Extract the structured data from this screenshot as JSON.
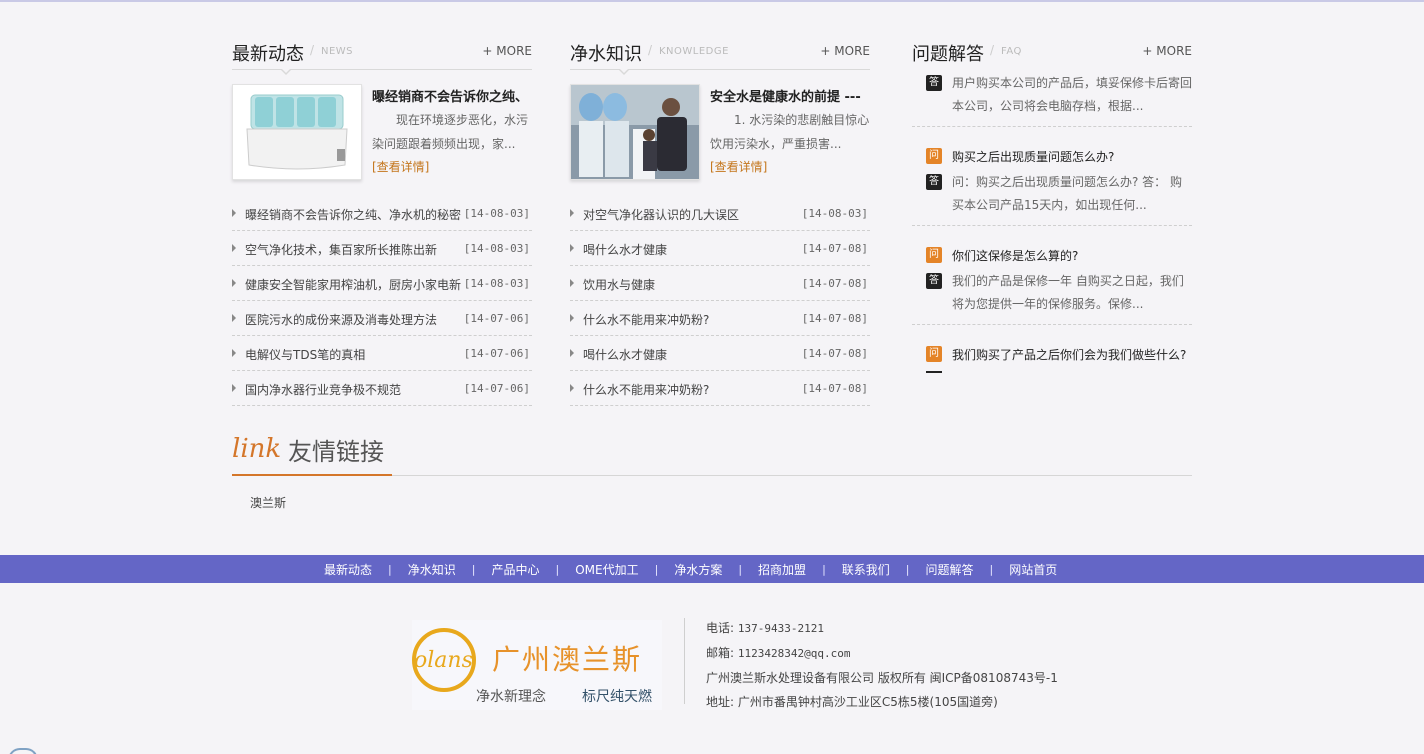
{
  "news": {
    "title": "最新动态",
    "en": "NEWS",
    "more": "+ MORE",
    "feature": {
      "title": "曝经销商不会告诉你之纯、",
      "desc": "现在环境逐步恶化，水污染问题跟着频频出现，家...",
      "link": "[查看详情]"
    },
    "items": [
      {
        "text": "曝经销商不会告诉你之纯、净水机的秘密",
        "date": "[14-08-03]"
      },
      {
        "text": "空气净化技术，集百家所长推陈出新",
        "date": "[14-08-03]"
      },
      {
        "text": "健康安全智能家用榨油机，厨房小家电新",
        "date": "[14-08-03]"
      },
      {
        "text": "医院污水的成份来源及消毒处理方法",
        "date": "[14-07-06]"
      },
      {
        "text": "电解仪与TDS笔的真相",
        "date": "[14-07-06]"
      },
      {
        "text": "国内净水器行业竞争极不规范",
        "date": "[14-07-06]"
      }
    ]
  },
  "knowledge": {
    "title": "净水知识",
    "en": "KNOWLEDGE",
    "more": "+ MORE",
    "feature": {
      "title": "安全水是健康水的前提 ---",
      "desc": "1. 水污染的悲剧触目惊心饮用污染水，严重损害...",
      "link": "[查看详情]"
    },
    "items": [
      {
        "text": "对空气净化器认识的几大误区",
        "date": "[14-08-03]"
      },
      {
        "text": "喝什么水才健康",
        "date": "[14-07-08]"
      },
      {
        "text": "饮用水与健康",
        "date": "[14-07-08]"
      },
      {
        "text": "什么水不能用来冲奶粉?",
        "date": "[14-07-08]"
      },
      {
        "text": "喝什么水才健康",
        "date": "[14-07-08]"
      },
      {
        "text": "什么水不能用来冲奶粉?",
        "date": "[14-07-08]"
      }
    ]
  },
  "faq": {
    "title": "问题解答",
    "en": "FAQ",
    "more": "+ MORE",
    "q_badge": "问",
    "a_badge": "答",
    "first_answer": "用户购买本公司的产品后，填妥保修卡后寄回本公司，公司将会电脑存档，根据...",
    "items": [
      {
        "q": "购买之后出现质量问题怎么办?",
        "a": "问：购买之后出现质量问题怎么办? 答： 购买本公司产品15天内，如出现任何..."
      },
      {
        "q": "你们这保修是怎么算的?",
        "a": "我们的产品是保修一年 自购买之日起，我们将为您提供一年的保修服务。保修..."
      },
      {
        "q": "我们购买了产品之后你们会为我们做些什么?",
        "a": ""
      }
    ]
  },
  "links": {
    "script": "link",
    "title": "友情链接",
    "items": [
      "澳兰斯"
    ]
  },
  "nav": {
    "items": [
      "最新动态",
      "净水知识",
      "产品中心",
      "OME代加工",
      "净水方案",
      "招商加盟",
      "联系我们",
      "问题解答",
      "网站首页"
    ],
    "sep": "|"
  },
  "footer": {
    "logo_mark": "olans",
    "logo_cn": "广州澳兰斯",
    "slogan1": "净水新理念",
    "slogan2": "标尺纯天燃",
    "phone_label": "电话:",
    "phone": "137-9433-2121",
    "email_label": "邮箱:",
    "email": "1123428342@qq.com",
    "copyright": "广州澳兰斯水处理设备有限公司 版权所有 闽ICP备08108743号-1",
    "address_label": "地址:",
    "address": "广州市番禺钟村高沙工业区C5栋5楼(105国道旁)"
  }
}
